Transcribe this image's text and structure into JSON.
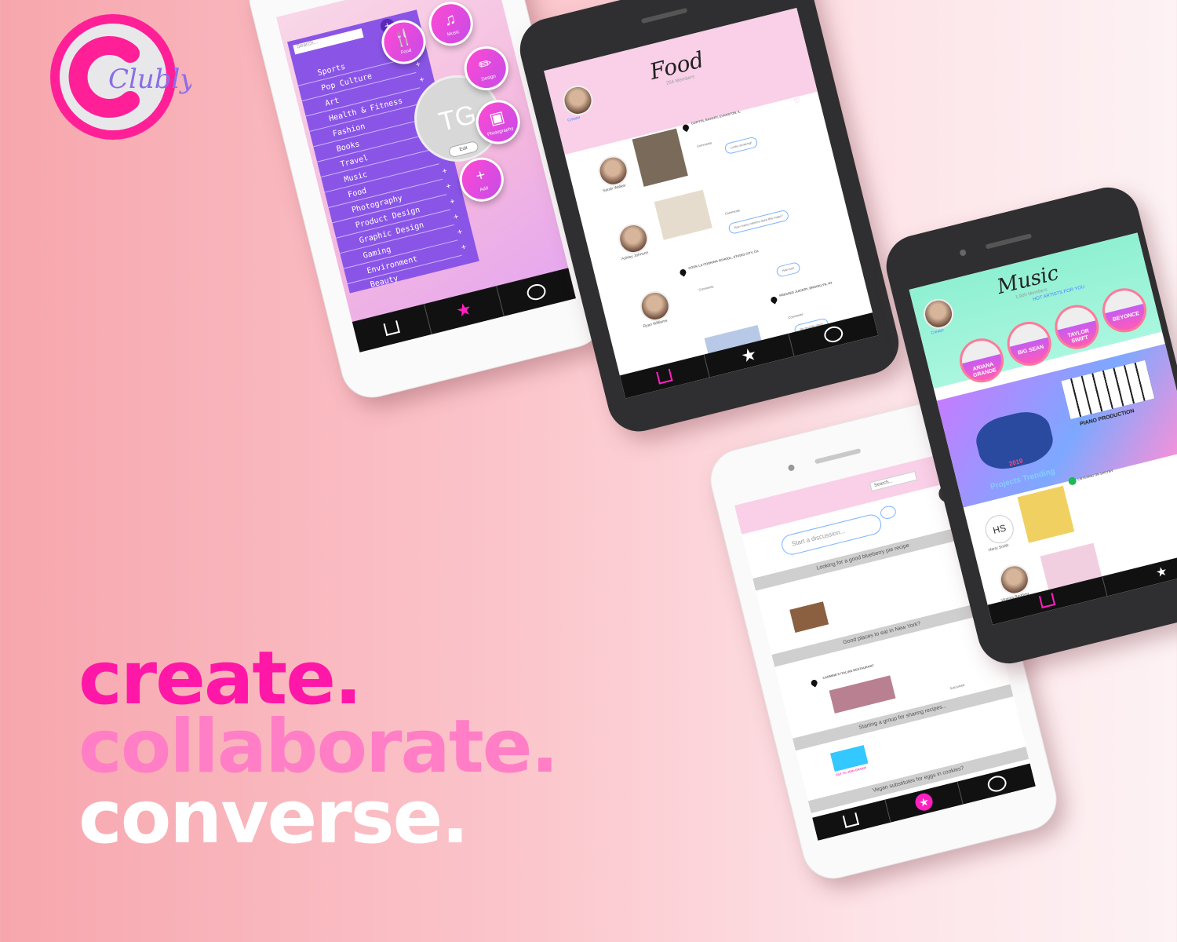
{
  "brand": {
    "name": "Clubly",
    "accent": "#ff2098",
    "ring": "#e8e8ea"
  },
  "slogans": {
    "create": "create.",
    "collaborate": "collaborate.",
    "converse": "converse."
  },
  "phone_categories": {
    "search_placeholder": "Search...",
    "categories": [
      "Sports",
      "Pop Culture",
      "Art",
      "Health & Fitness",
      "Fashion",
      "Books",
      "Travel",
      "Music",
      "Food",
      "Photography",
      "Product Design",
      "Graphic Design",
      "Gaming",
      "Environment",
      "Beauty"
    ],
    "tiles": {
      "food": "Food",
      "music": "Music",
      "design": "Design",
      "photography": "Photography",
      "add": "Add"
    },
    "profile_initials": "TG",
    "edit_label": "Edit"
  },
  "phone_food": {
    "title": "Food",
    "members": "254 Members",
    "creator_label": "Creator",
    "posts": [
      {
        "name": "Sarah Walker",
        "location": "CUPITOL BAKERY, EVANSTON, IL",
        "comments": "Comments",
        "reply": "Looks amazing!"
      },
      {
        "name": "Ashley Johnson",
        "location": "",
        "comments": "Comments",
        "reply": "How many calories does this make?"
      },
      {
        "name": "Ryan Williams",
        "location": "COOK LA COOKING SCHOOL, STUDIO CITY, CA",
        "comments": "Comments",
        "reply": "How fun!"
      },
      {
        "name": "Rachel Adams",
        "location": "PRESSED JUICERY, BROOKLYN, NY",
        "comments": "Comments",
        "reply": "My favorite place"
      }
    ]
  },
  "phone_discussion": {
    "search_placeholder": "Search...",
    "start_placeholder": "Start a discussion...",
    "topics": [
      "Looking for a good blueberry pie recipe",
      "Good places to eat in New York?",
      "Starting a group for sharing recipes...",
      "Vegan substitutes for eggs in cookies?"
    ],
    "restaurant": "CARMINE'S ITALIAN RESTAURANT",
    "just_joined": "Just joined",
    "join_group": "TAP TO JOIN GROUP"
  },
  "phone_music": {
    "title": "Music",
    "members": "1,900 Members",
    "creator_label": "Creator",
    "hot_label": "HOT ARTISTS FOR YOU",
    "artists": [
      "ARIANA GRANDE",
      "BIG SEAN",
      "TAYLOR SWIFT",
      "BEYONCE"
    ],
    "trending": "Projects Trending",
    "piano": "PIANO PRODUCTION",
    "year": "2019",
    "listening": "LISTENING ON SPOTIFY",
    "users": [
      {
        "initials": "HS",
        "name": "Harry Smith"
      },
      {
        "initials": "",
        "name": "Virginia Redding"
      }
    ]
  }
}
